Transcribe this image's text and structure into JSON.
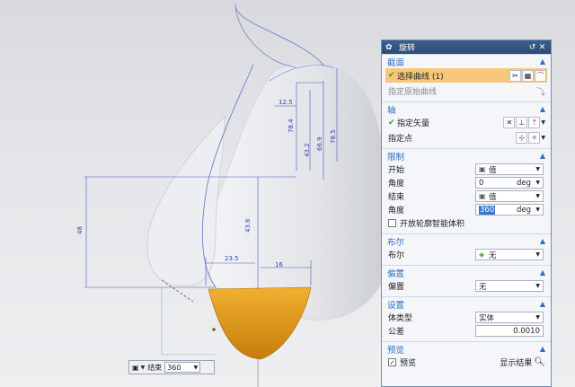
{
  "dialog": {
    "title": "旋转",
    "sections": {
      "section": {
        "title": "截面",
        "select_curve": "选择曲线 (1)",
        "specify_origin_curve": "指定原始曲线"
      },
      "axis": {
        "title": "轴",
        "specify_vector": "指定矢量",
        "specify_point": "指定点"
      },
      "limits": {
        "title": "限制",
        "start_label": "开始",
        "start_value": "值",
        "start_angle_label": "角度",
        "start_angle_value": "0",
        "start_angle_unit": "deg",
        "end_label": "结束",
        "end_value": "值",
        "end_angle_label": "角度",
        "end_angle_value": "360",
        "end_angle_unit": "deg",
        "open_profile_label": "开放轮廓智能体积"
      },
      "boolean": {
        "title": "布尔",
        "label": "布尔",
        "value": "无"
      },
      "offset": {
        "title": "偏置",
        "label": "偏置",
        "value": "无"
      },
      "settings": {
        "title": "设置",
        "body_type_label": "体类型",
        "body_type_value": "实体",
        "tolerance_label": "公差",
        "tolerance_value": "0.0010"
      },
      "preview": {
        "title": "预览",
        "preview_label": "预览",
        "show_result": "显示结果"
      }
    }
  },
  "mini_toolbar": {
    "label": "结束",
    "value": "360"
  },
  "dimensions": {
    "d1": "12.5",
    "d2": "78.4",
    "d3": "43.2",
    "d4": "66.9",
    "d5": "78.5",
    "d6": "48",
    "d7": "43.6",
    "d8": "23.5",
    "d9": "16"
  },
  "colors": {
    "accent": "#2e6fbf",
    "highlight": "#f7c87c",
    "solid_face": "#e5a21c",
    "titlebar": "#2e4c74"
  }
}
